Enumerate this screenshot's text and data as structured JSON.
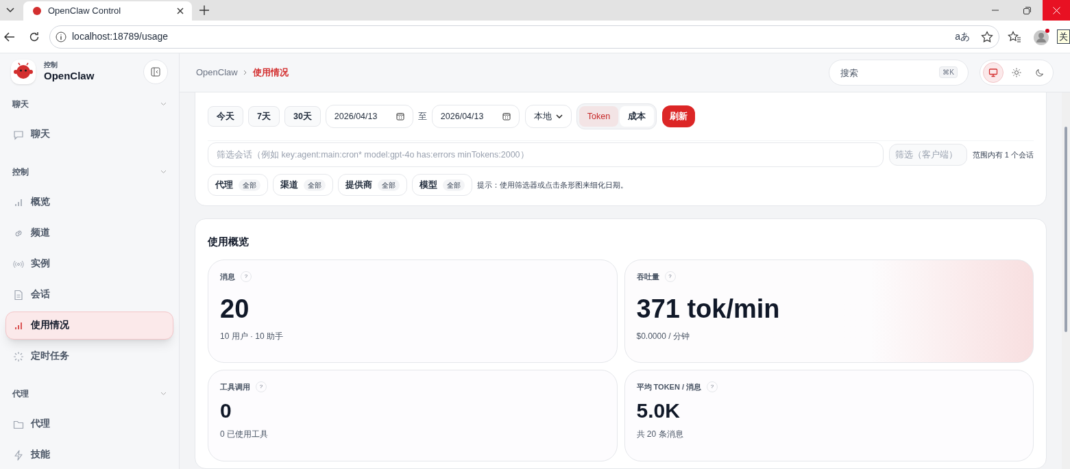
{
  "browser": {
    "tab_title": "OpenClaw Control",
    "url": "localhost:18789/usage",
    "translate": "aあ",
    "tooltip": "关"
  },
  "brand": {
    "kicker": "控制",
    "name": "OpenClaw"
  },
  "breadcrumb": [
    "OpenClaw",
    "使用情况"
  ],
  "search": {
    "placeholder": "搜索",
    "shortcut": "⌘K"
  },
  "theme_modes": [
    {
      "kind": "system",
      "selected": true
    },
    {
      "kind": "light",
      "selected": false
    },
    {
      "kind": "dark",
      "selected": false
    }
  ],
  "sidebar": {
    "groups": [
      {
        "label": "聊天",
        "expanded": true,
        "items": [
          {
            "label": "聊天",
            "kind": "chat",
            "selected": false
          }
        ]
      },
      {
        "label": "控制",
        "expanded": true,
        "items": [
          {
            "label": "概览",
            "kind": "bars",
            "selected": false
          },
          {
            "label": "频道",
            "kind": "link",
            "selected": false
          },
          {
            "label": "实例",
            "kind": "radio",
            "selected": false
          },
          {
            "label": "会话",
            "kind": "doc",
            "selected": false
          },
          {
            "label": "使用情况",
            "kind": "bars",
            "selected": true
          },
          {
            "label": "定时任务",
            "kind": "loader",
            "selected": false
          }
        ]
      },
      {
        "label": "代理",
        "expanded": true,
        "items": [
          {
            "label": "代理",
            "kind": "folder",
            "selected": false
          },
          {
            "label": "技能",
            "kind": "bolt",
            "selected": false
          }
        ]
      }
    ]
  },
  "filters": {
    "range_buttons": [
      "今天",
      "7天",
      "30天"
    ],
    "date_from": "2026/04/13",
    "separator": "至",
    "date_to": "2026/04/13",
    "timezone": "本地",
    "mode_toggle": [
      {
        "label": "Token",
        "selected": true
      },
      {
        "label": "成本",
        "selected": false
      }
    ],
    "refresh": "刷新",
    "query": {
      "placeholder": "筛选会话（例如 key:agent:main:cron* model:gpt-4o has:errors minTokens:2000）"
    },
    "client_filter": {
      "placeholder": "筛选（客户端）"
    },
    "session_count": "范围内有 1 个会话",
    "facets": [
      {
        "label": "代理",
        "value": "全部"
      },
      {
        "label": "渠道",
        "value": "全部"
      },
      {
        "label": "提供商",
        "value": "全部"
      },
      {
        "label": "模型",
        "value": "全部"
      }
    ],
    "hint": "提示：使用筛选器或点击条形图来细化日期。"
  },
  "overview": {
    "title": "使用概览",
    "stats": [
      {
        "label": "消息",
        "help": "?",
        "value": "20",
        "sub": "10 用户 · 10 助手",
        "highlighted": false
      },
      {
        "label": "吞吐量",
        "help": "?",
        "value": "371 tok/min",
        "sub": "$0.0000 / 分钟",
        "highlighted": true
      },
      {
        "label": "工具调用",
        "help": "?",
        "value": "0",
        "sub": "0 已使用工具",
        "highlighted": false
      },
      {
        "label": "平均 TOKEN / 消息",
        "help": "?",
        "value": "5.0K",
        "sub": "共 20 条消息",
        "highlighted": false
      }
    ]
  }
}
